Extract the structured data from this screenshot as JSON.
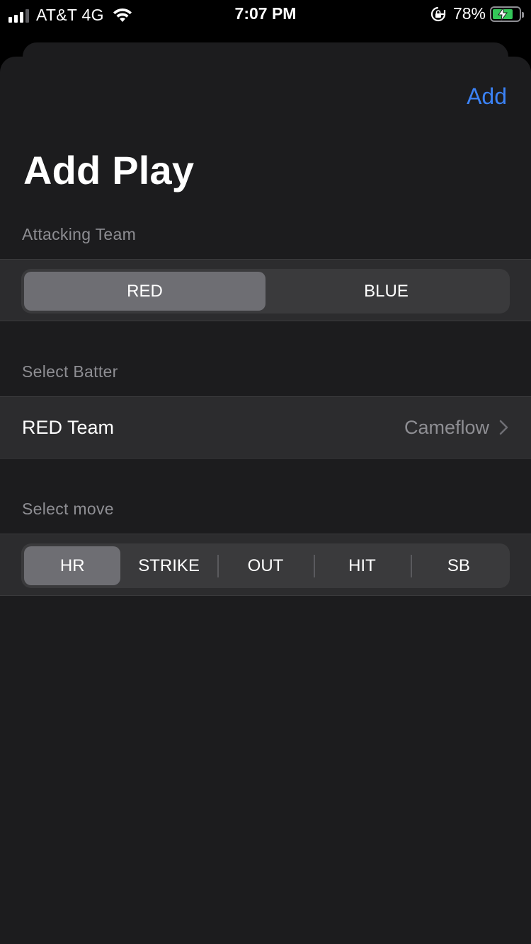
{
  "status_bar": {
    "carrier": "AT&T 4G",
    "time": "7:07 PM",
    "battery_percent": "78%",
    "signal_bars": 3,
    "battery_level": 0.78,
    "colors": {
      "battery_fill": "#34c759"
    }
  },
  "sheet": {
    "add_label": "Add",
    "title": "Add Play"
  },
  "attacking_team": {
    "header": "Attacking Team",
    "options": [
      "RED",
      "BLUE"
    ],
    "selected": "RED"
  },
  "batter": {
    "header": "Select Batter",
    "row_label": "RED Team",
    "row_value": "Cameflow"
  },
  "move": {
    "header": "Select move",
    "options": [
      "HR",
      "STRIKE",
      "OUT",
      "HIT",
      "SB"
    ],
    "selected": "HR"
  },
  "colors": {
    "accent": "#3b82f6",
    "sheet_background": "#1c1c1e",
    "row_background": "#2c2c2e",
    "secondary_text": "#8e8e93"
  }
}
